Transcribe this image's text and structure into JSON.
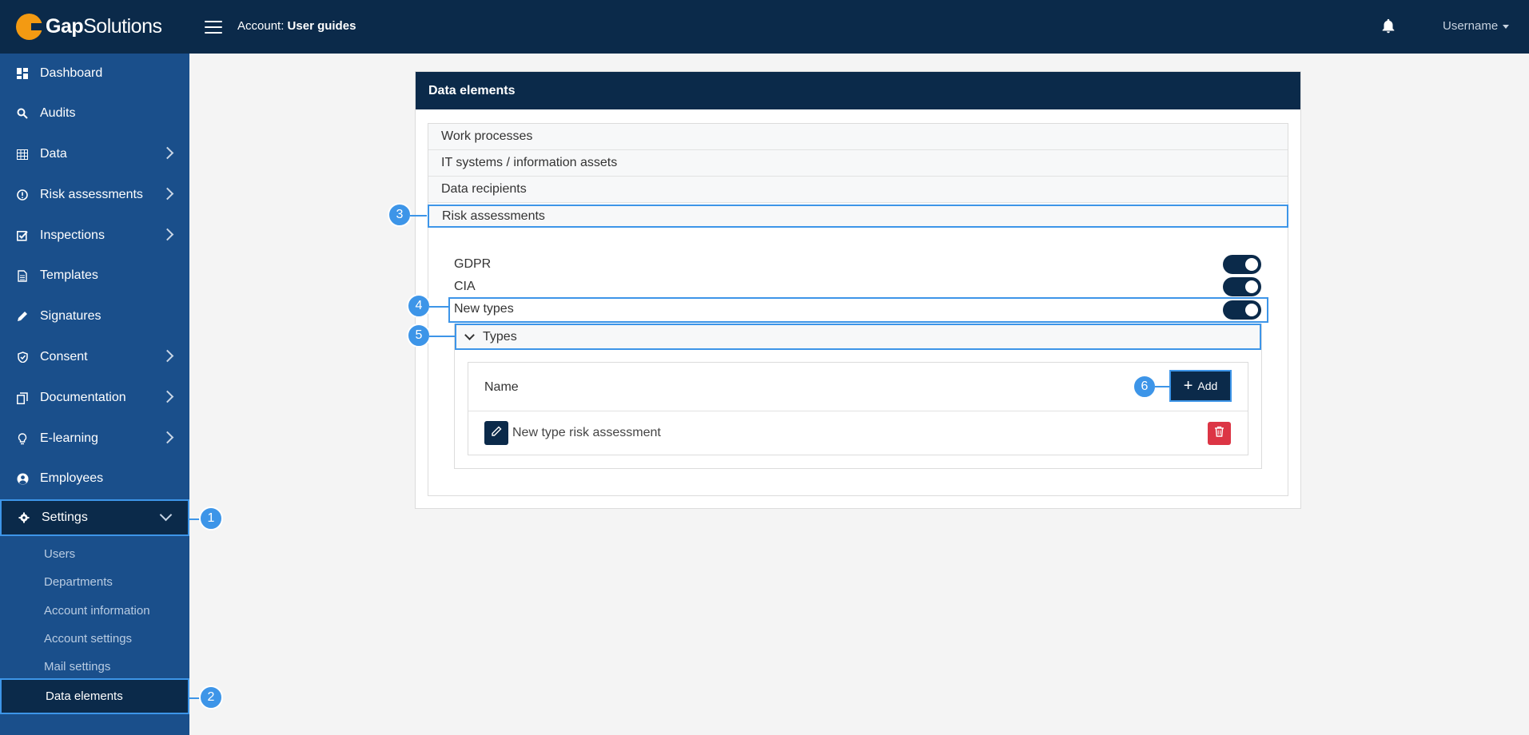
{
  "app": {
    "logo_bold": "Gap",
    "logo_light": "Solutions",
    "account_label": "Account:",
    "account_value": "User guides",
    "username": "Username"
  },
  "sidebar": {
    "items": [
      {
        "label": "Dashboard",
        "icon": "dashboard-icon"
      },
      {
        "label": "Audits",
        "icon": "search-icon"
      },
      {
        "label": "Data",
        "icon": "table-icon"
      },
      {
        "label": "Risk assessments",
        "icon": "alert-circle-icon"
      },
      {
        "label": "Inspections",
        "icon": "checkbox-icon"
      },
      {
        "label": "Templates",
        "icon": "document-icon"
      },
      {
        "label": "Signatures",
        "icon": "pen-icon"
      },
      {
        "label": "Consent",
        "icon": "shield-icon"
      },
      {
        "label": "Documentation",
        "icon": "copy-icon"
      },
      {
        "label": "E-learning",
        "icon": "lightbulb-icon"
      },
      {
        "label": "Employees",
        "icon": "user-circle-icon"
      },
      {
        "label": "Settings",
        "icon": "gear-icon"
      }
    ],
    "settings_sub": [
      "Users",
      "Departments",
      "Account information",
      "Account settings",
      "Mail settings",
      "Data elements"
    ]
  },
  "callouts": [
    "1",
    "2",
    "3",
    "4",
    "5",
    "6"
  ],
  "card": {
    "title": "Data elements",
    "sections": [
      "Work processes",
      "IT systems / information assets",
      "Data recipients",
      "Risk assessments"
    ],
    "options": [
      {
        "label": "GDPR",
        "enabled": true
      },
      {
        "label": "CIA",
        "enabled": true
      },
      {
        "label": "New types",
        "enabled": true
      }
    ],
    "types_label": "Types",
    "table_header": "Name",
    "add_label": "Add",
    "rows": [
      "New type risk assessment"
    ]
  },
  "colors": {
    "navy": "#0b2a4a",
    "sidebar": "#1a4f8b",
    "highlight": "#3d95e8",
    "logo": "#f39a12",
    "danger": "#dc3545"
  }
}
